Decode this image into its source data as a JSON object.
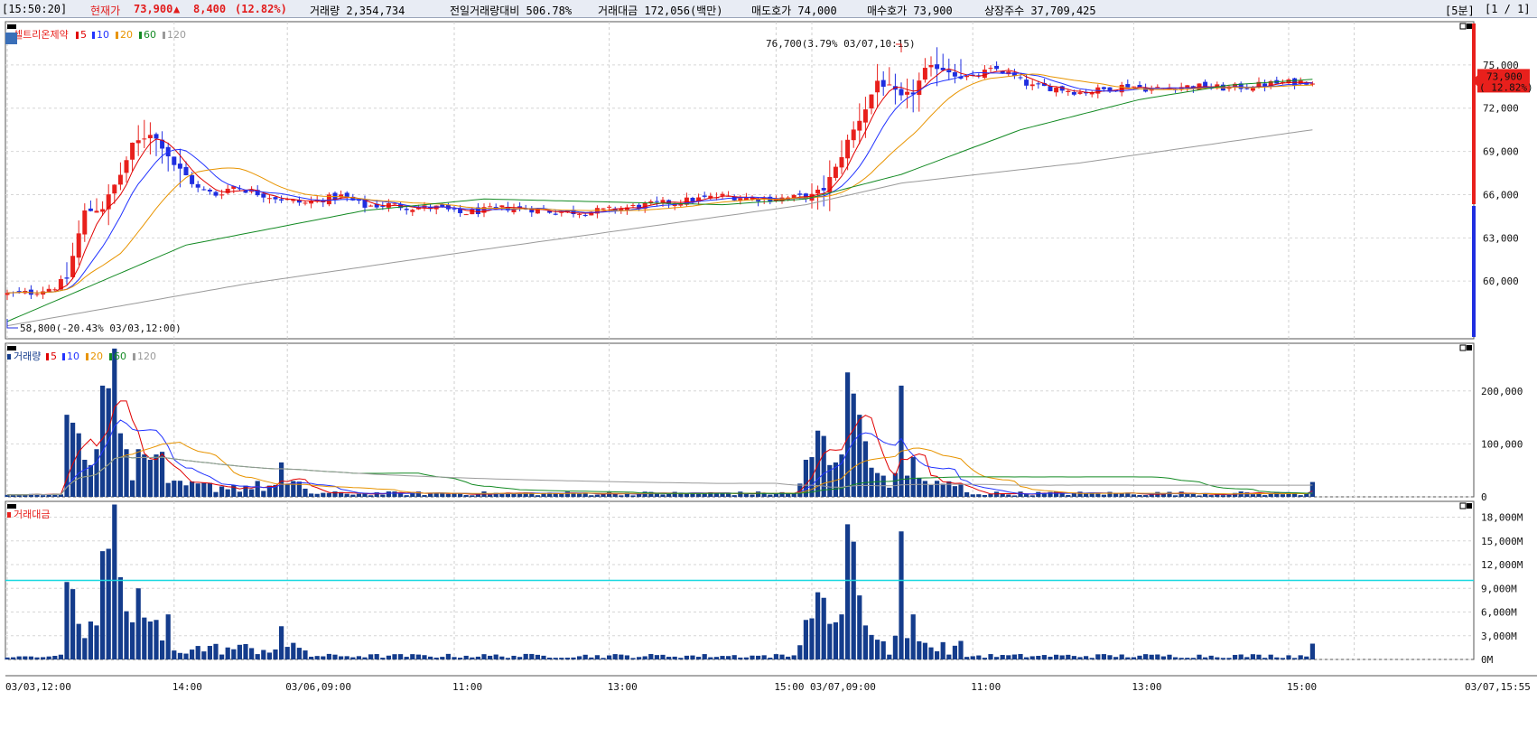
{
  "header": {
    "time": "[15:50:20]",
    "price_label": "현재가",
    "price": "73,900",
    "arrow": "▲",
    "change": "8,400",
    "change_pct": "(12.82%)",
    "volume_text": "거래량 2,354,734",
    "prev_ratio_text": "전일거래량대비 506.78%",
    "amount_text": "거래대금 172,056(백만)",
    "ask_text": "매도호가 74,000",
    "bid_text": "매수호가 73,900",
    "shares_text": "상장주수 37,709,425",
    "interval": "[5분]",
    "page": "[1 / 1]"
  },
  "colors": {
    "up": "#e8201c",
    "down": "#1f2ee0",
    "ma5": "#e00000",
    "ma10": "#2233ff",
    "ma20": "#e89400",
    "ma60": "#138a23",
    "ma120": "#9a9a9a",
    "volume": "#143c8c",
    "hline": "#19d8e0"
  },
  "chart_data": [
    {
      "type": "candlestick",
      "name": "셀트리온제약",
      "legend": [
        "5",
        "10",
        "20",
        "60",
        "120"
      ],
      "ylim": [
        56000,
        78000
      ],
      "yticks": [
        "75,000",
        "72,000",
        "69,000",
        "66,000",
        "63,000",
        "60,000"
      ],
      "ytick_values": [
        75000,
        72000,
        69000,
        66000,
        63000,
        60000
      ],
      "current_price": "73,900",
      "current_pct": "( 12.82%)",
      "high_annotation": "76,700(3.79% 03/07,10:15)",
      "low_annotation": "58,800(-20.43% 03/03,12:00)",
      "anchors": [
        [
          0,
          59100
        ],
        [
          4,
          59200
        ],
        [
          8,
          59600
        ],
        [
          10,
          60200
        ],
        [
          13,
          64800
        ],
        [
          16,
          65100
        ],
        [
          19,
          67400
        ],
        [
          21,
          69400
        ],
        [
          24,
          70300
        ],
        [
          26,
          69400
        ],
        [
          28,
          68100
        ],
        [
          30,
          67300
        ],
        [
          32,
          66400
        ],
        [
          35,
          66000
        ],
        [
          38,
          66600
        ],
        [
          41,
          66200
        ],
        [
          44,
          65900
        ],
        [
          47,
          65600
        ],
        [
          50,
          65400
        ],
        [
          53,
          65700
        ],
        [
          56,
          65900
        ],
        [
          60,
          65200
        ],
        [
          64,
          65300
        ],
        [
          68,
          65100
        ],
        [
          72,
          65100
        ],
        [
          76,
          64700
        ],
        [
          80,
          64900
        ],
        [
          84,
          65100
        ],
        [
          88,
          65000
        ],
        [
          92,
          64800
        ],
        [
          96,
          64800
        ],
        [
          100,
          64900
        ],
        [
          104,
          65100
        ],
        [
          108,
          65300
        ],
        [
          112,
          65500
        ],
        [
          116,
          65700
        ],
        [
          120,
          65900
        ],
        [
          124,
          65800
        ],
        [
          128,
          65700
        ],
        [
          132,
          65800
        ],
        [
          135,
          65900
        ],
        [
          137,
          66400
        ],
        [
          139,
          67800
        ],
        [
          141,
          69700
        ],
        [
          144,
          72000
        ],
        [
          146,
          73900
        ],
        [
          148,
          73400
        ],
        [
          150,
          72700
        ],
        [
          152,
          73100
        ],
        [
          154,
          74600
        ],
        [
          156,
          74900
        ],
        [
          158,
          74600
        ],
        [
          160,
          74200
        ],
        [
          162,
          74100
        ],
        [
          164,
          74500
        ],
        [
          166,
          74700
        ],
        [
          168,
          74400
        ],
        [
          170,
          73900
        ],
        [
          172,
          73500
        ],
        [
          176,
          73400
        ],
        [
          180,
          73100
        ],
        [
          184,
          73300
        ],
        [
          188,
          73600
        ],
        [
          192,
          73300
        ],
        [
          196,
          73500
        ],
        [
          200,
          73500
        ],
        [
          204,
          73400
        ],
        [
          208,
          73500
        ],
        [
          212,
          73700
        ],
        [
          216,
          73800
        ],
        [
          219,
          73900
        ]
      ],
      "ma60": [
        [
          0,
          57200
        ],
        [
          30,
          62500
        ],
        [
          60,
          64900
        ],
        [
          80,
          65700
        ],
        [
          120,
          65300
        ],
        [
          134,
          65700
        ],
        [
          150,
          67400
        ],
        [
          170,
          70500
        ],
        [
          190,
          72600
        ],
        [
          205,
          73600
        ],
        [
          219,
          74000
        ]
      ],
      "ma120": [
        [
          0,
          56900
        ],
        [
          40,
          59800
        ],
        [
          80,
          62200
        ],
        [
          120,
          64500
        ],
        [
          134,
          65300
        ],
        [
          150,
          66800
        ],
        [
          180,
          68200
        ],
        [
          219,
          70500
        ]
      ]
    },
    {
      "type": "bar",
      "name": "거래량",
      "legend": [
        "5",
        "10",
        "20",
        "60",
        "120"
      ],
      "ylim": [
        0,
        290000
      ],
      "yticks": [
        "200,000",
        "100,000",
        "0"
      ],
      "ytick_values": [
        200000,
        100000,
        0
      ],
      "peaks": [
        [
          10,
          155000
        ],
        [
          11,
          140000
        ],
        [
          12,
          120000
        ],
        [
          13,
          70000
        ],
        [
          14,
          60000
        ],
        [
          15,
          90000
        ],
        [
          16,
          210000
        ],
        [
          17,
          205000
        ],
        [
          18,
          280000
        ],
        [
          19,
          120000
        ],
        [
          20,
          90000
        ],
        [
          22,
          90000
        ],
        [
          23,
          80000
        ],
        [
          24,
          70000
        ],
        [
          25,
          80000
        ],
        [
          26,
          85000
        ],
        [
          46,
          65000
        ],
        [
          133,
          25000
        ],
        [
          134,
          70000
        ],
        [
          135,
          75000
        ],
        [
          136,
          125000
        ],
        [
          137,
          115000
        ],
        [
          138,
          60000
        ],
        [
          139,
          65000
        ],
        [
          140,
          80000
        ],
        [
          141,
          235000
        ],
        [
          142,
          195000
        ],
        [
          143,
          155000
        ],
        [
          144,
          105000
        ],
        [
          145,
          55000
        ],
        [
          146,
          45000
        ],
        [
          147,
          40000
        ],
        [
          149,
          45000
        ],
        [
          150,
          210000
        ],
        [
          151,
          40000
        ],
        [
          152,
          75000
        ],
        [
          153,
          35000
        ],
        [
          154,
          30000
        ],
        [
          219,
          28000
        ]
      ],
      "ma_y_values_note": "",
      "hline": null
    },
    {
      "type": "bar",
      "name": "거래대금",
      "ylim": [
        0,
        20000
      ],
      "yticks": [
        "18,000M",
        "15,000M",
        "12,000M",
        "9,000M",
        "6,000M",
        "3,000M",
        "0M"
      ],
      "ytick_values": [
        18000,
        15000,
        12000,
        9000,
        6000,
        3000,
        0
      ],
      "hline_value": 10000,
      "peaks": [
        [
          10,
          9800
        ],
        [
          11,
          8900
        ],
        [
          12,
          4500
        ],
        [
          13,
          2700
        ],
        [
          14,
          4800
        ],
        [
          15,
          4300
        ],
        [
          16,
          13700
        ],
        [
          17,
          14000
        ],
        [
          18,
          19600
        ],
        [
          19,
          10400
        ],
        [
          20,
          6100
        ],
        [
          21,
          4700
        ],
        [
          22,
          9000
        ],
        [
          23,
          5300
        ],
        [
          24,
          4800
        ],
        [
          25,
          5000
        ],
        [
          26,
          2400
        ],
        [
          27,
          5700
        ],
        [
          46,
          4200
        ],
        [
          133,
          1800
        ],
        [
          134,
          5000
        ],
        [
          135,
          5200
        ],
        [
          136,
          8500
        ],
        [
          137,
          7800
        ],
        [
          138,
          4500
        ],
        [
          139,
          4700
        ],
        [
          140,
          5700
        ],
        [
          141,
          17100
        ],
        [
          142,
          14900
        ],
        [
          143,
          8100
        ],
        [
          144,
          4300
        ],
        [
          145,
          3100
        ],
        [
          146,
          2500
        ],
        [
          147,
          2300
        ],
        [
          149,
          3000
        ],
        [
          150,
          16200
        ],
        [
          151,
          2700
        ],
        [
          152,
          5700
        ],
        [
          153,
          2300
        ],
        [
          154,
          2100
        ],
        [
          219,
          2000
        ]
      ]
    }
  ],
  "x_axis": {
    "labels": [
      {
        "i": 0,
        "text": "03/03,12:00"
      },
      {
        "i": 28,
        "text": "14:00"
      },
      {
        "i": 47,
        "text": "03/06,09:00"
      },
      {
        "i": 75,
        "text": "11:00"
      },
      {
        "i": 101,
        "text": "13:00"
      },
      {
        "i": 129,
        "text": "15:00"
      },
      {
        "i": 135,
        "text": "03/07,09:00"
      },
      {
        "i": 162,
        "text": "11:00"
      },
      {
        "i": 189,
        "text": "13:00"
      },
      {
        "i": 215,
        "text": "15:00"
      },
      {
        "i": 226,
        "text": "03/07,15:55"
      }
    ]
  }
}
